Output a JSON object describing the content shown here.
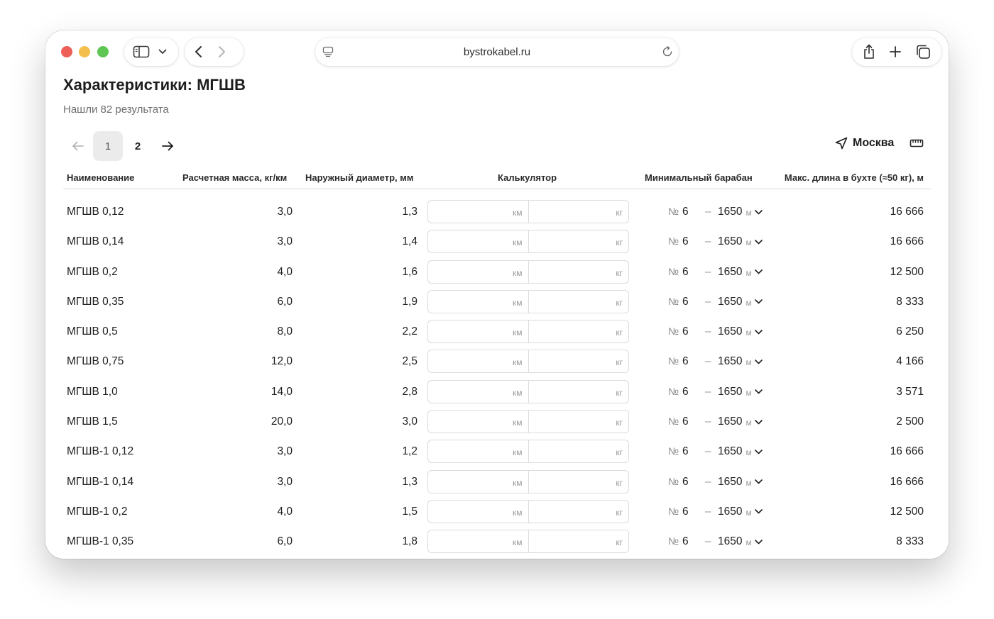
{
  "browser": {
    "url": "bystrokabel.ru"
  },
  "page": {
    "title": "Характеристики: МГШВ",
    "results": "Нашли 82 результата"
  },
  "pagination": {
    "pages": [
      "1",
      "2"
    ],
    "active": "1"
  },
  "location": {
    "city": "Москва"
  },
  "table": {
    "headers": {
      "name": "Наименование",
      "mass": "Расчетная масса, кг/км",
      "diameter": "Наружный диаметр, мм",
      "calculator": "Калькулятор",
      "drum": "Минимальный барабан",
      "max_length": "Макс. длина в бухте (≈50 кг), м"
    },
    "calc_units": {
      "length": "км",
      "weight": "кг"
    },
    "drum_prefix": "№",
    "dash": "–",
    "length_unit": "м",
    "rows": [
      {
        "name": "МГШВ 0,12",
        "mass": "3,0",
        "diameter": "1,3",
        "drum": "6",
        "length": "1650",
        "max_length": "16 666"
      },
      {
        "name": "МГШВ 0,14",
        "mass": "3,0",
        "diameter": "1,4",
        "drum": "6",
        "length": "1650",
        "max_length": "16 666"
      },
      {
        "name": "МГШВ 0,2",
        "mass": "4,0",
        "diameter": "1,6",
        "drum": "6",
        "length": "1650",
        "max_length": "12 500"
      },
      {
        "name": "МГШВ 0,35",
        "mass": "6,0",
        "diameter": "1,9",
        "drum": "6",
        "length": "1650",
        "max_length": "8 333"
      },
      {
        "name": "МГШВ 0,5",
        "mass": "8,0",
        "diameter": "2,2",
        "drum": "6",
        "length": "1650",
        "max_length": "6 250"
      },
      {
        "name": "МГШВ 0,75",
        "mass": "12,0",
        "diameter": "2,5",
        "drum": "6",
        "length": "1650",
        "max_length": "4 166"
      },
      {
        "name": "МГШВ 1,0",
        "mass": "14,0",
        "diameter": "2,8",
        "drum": "6",
        "length": "1650",
        "max_length": "3 571"
      },
      {
        "name": "МГШВ 1,5",
        "mass": "20,0",
        "diameter": "3,0",
        "drum": "6",
        "length": "1650",
        "max_length": "2 500"
      },
      {
        "name": "МГШВ-1 0,12",
        "mass": "3,0",
        "diameter": "1,2",
        "drum": "6",
        "length": "1650",
        "max_length": "16 666"
      },
      {
        "name": "МГШВ-1 0,14",
        "mass": "3,0",
        "diameter": "1,3",
        "drum": "6",
        "length": "1650",
        "max_length": "16 666"
      },
      {
        "name": "МГШВ-1 0,2",
        "mass": "4,0",
        "diameter": "1,5",
        "drum": "6",
        "length": "1650",
        "max_length": "12 500"
      },
      {
        "name": "МГШВ-1 0,35",
        "mass": "6,0",
        "diameter": "1,8",
        "drum": "6",
        "length": "1650",
        "max_length": "8 333"
      }
    ]
  }
}
